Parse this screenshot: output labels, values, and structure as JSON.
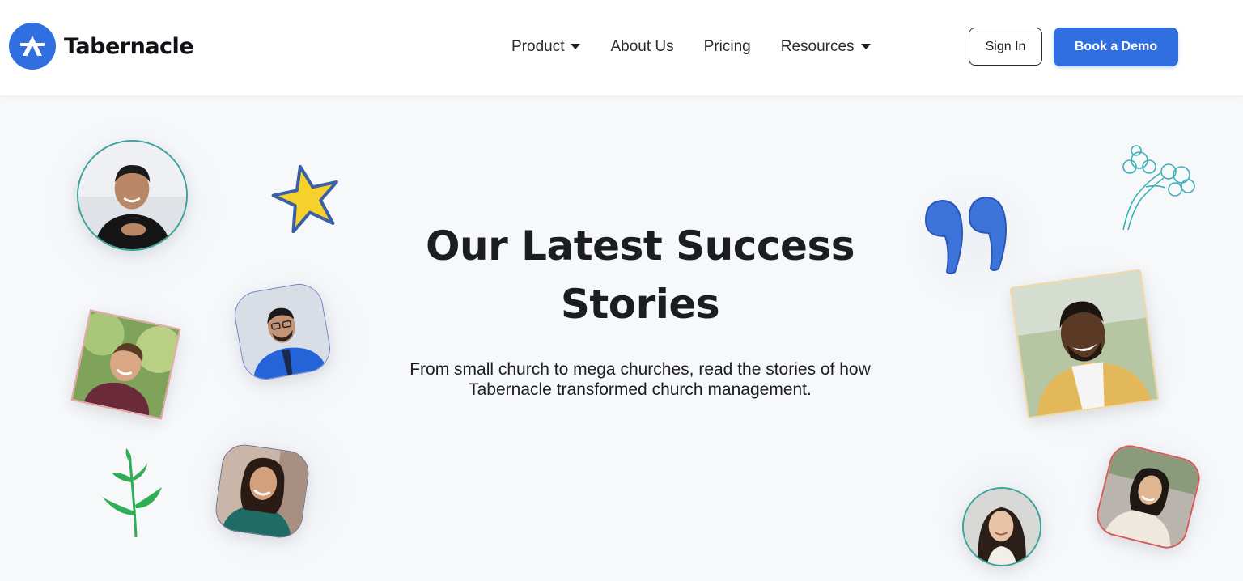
{
  "brand": {
    "name": "Tabernacle",
    "logo_icon": "tabernacle-logo-icon",
    "accent": "#2f6fe0"
  },
  "nav": {
    "items": [
      {
        "label": "Product",
        "has_dropdown": true
      },
      {
        "label": "About Us",
        "has_dropdown": false
      },
      {
        "label": "Pricing",
        "has_dropdown": false
      },
      {
        "label": "Resources",
        "has_dropdown": true
      }
    ]
  },
  "auth": {
    "sign_in_label": "Sign In",
    "demo_label": "Book a Demo"
  },
  "hero": {
    "title_line1": "Our Latest Success",
    "title_line2": "Stories",
    "subtitle_line1": "From small church to mega churches, read the stories of how",
    "subtitle_line2": "Tabernacle transformed church management."
  },
  "decorations": {
    "icons": [
      "star-icon",
      "quote-icon",
      "tree-icon",
      "sprout-icon"
    ],
    "photos": [
      "testimonial-photo"
    ]
  }
}
